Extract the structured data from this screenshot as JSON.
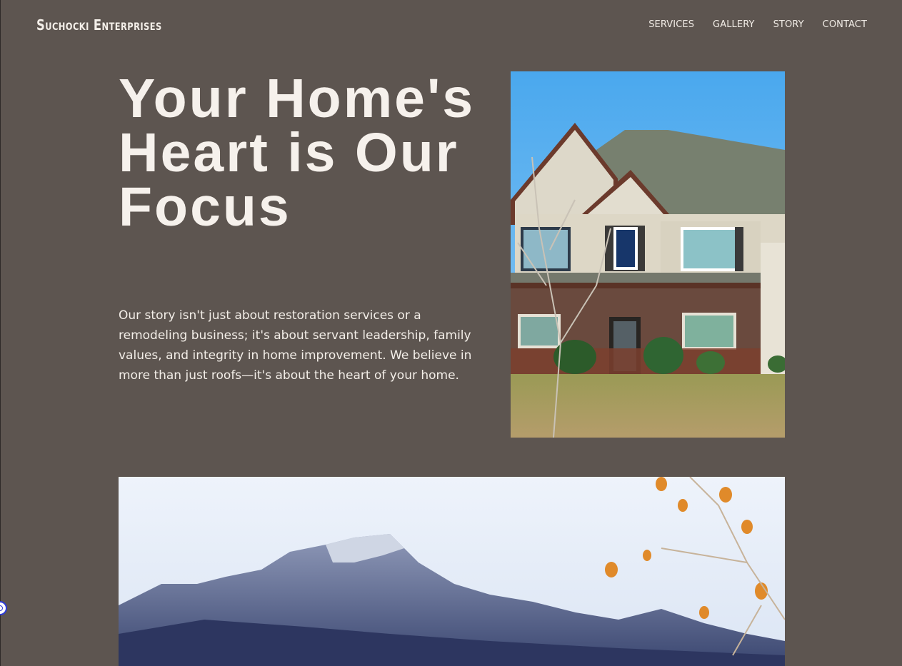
{
  "header": {
    "brand": "Suchocki Enterprises",
    "nav": [
      {
        "label": "SERVICES"
      },
      {
        "label": "GALLERY"
      },
      {
        "label": "STORY"
      },
      {
        "label": "CONTACT"
      }
    ]
  },
  "hero": {
    "title_lines": [
      "Your Home's",
      "Heart is Our",
      "Focus"
    ],
    "body": "Our story isn't just about restoration services or a remodeling business; it's about servant leadership, family values, and integrity in home improvement. We believe in more than just roofs—it's about the heart of your home."
  },
  "images": {
    "house": "house-photo",
    "mountain": "mountain-photo"
  },
  "widgets": {
    "accessibility": "accessibility-icon"
  }
}
